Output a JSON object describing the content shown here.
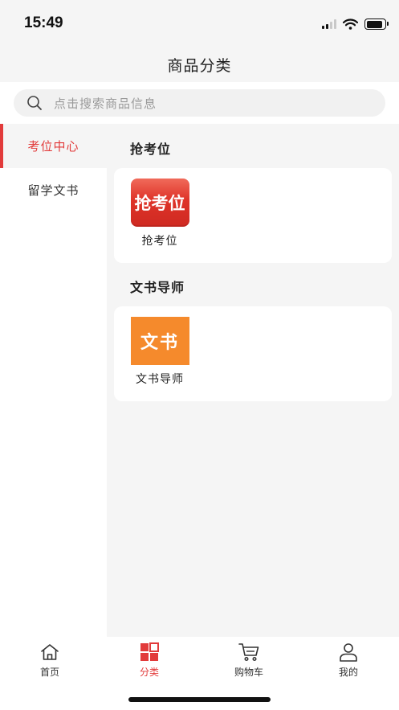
{
  "status_bar": {
    "time": "15:49",
    "battery_level": 0.9
  },
  "nav": {
    "title": "商品分类"
  },
  "search": {
    "placeholder": "点击搜索商品信息"
  },
  "sidebar": {
    "items": [
      {
        "label": "考位中心",
        "active": true
      },
      {
        "label": "留学文书",
        "active": false
      }
    ]
  },
  "sections": [
    {
      "title": "抢考位",
      "products": [
        {
          "thumb_text": "抢考位",
          "label": "抢考位"
        }
      ]
    },
    {
      "title": "文书导师",
      "products": [
        {
          "thumb_text": "文书",
          "label": "文书导师"
        }
      ]
    }
  ],
  "tabbar": {
    "items": [
      {
        "label": "首页",
        "icon": "home-icon",
        "active": false
      },
      {
        "label": "分类",
        "icon": "category-icon",
        "active": true
      },
      {
        "label": "购物车",
        "icon": "cart-icon",
        "active": false
      },
      {
        "label": "我的",
        "icon": "profile-icon",
        "active": false
      }
    ]
  },
  "colors": {
    "accent": "#e23b3b",
    "background": "#f5f5f5",
    "thumb_red": "#de3328",
    "thumb_orange": "#f58a2c"
  }
}
